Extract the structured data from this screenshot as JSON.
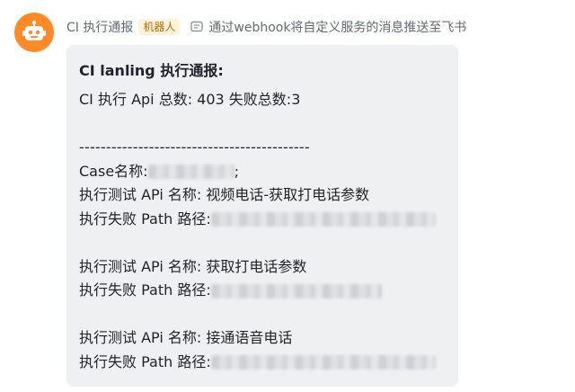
{
  "sender": {
    "name": "CI 执行通报",
    "badge": "机器人",
    "subtitle": "通过webhook将自定义服务的消息推送至飞书",
    "avatar_color": "#ff8a26"
  },
  "message": {
    "title": "CI lanling 执行通报:",
    "summary": "CI 执行 Api 总数: 403  失败总数:3",
    "divider": "-------------------------------------------",
    "case_label": "Case名称:",
    "case_trailing": ";",
    "entries": [
      {
        "api_label": "执行测试 APi 名称: 视频电话-获取打电话参数",
        "path_label": "执行失败 Path 路径:"
      },
      {
        "api_label": "执行测试 APi 名称: 获取打电话参数",
        "path_label": "执行失败 Path 路径:"
      },
      {
        "api_label": "执行测试 APi 名称: 接通语音电话",
        "path_label": "执行失败 Path 路径:"
      }
    ]
  }
}
